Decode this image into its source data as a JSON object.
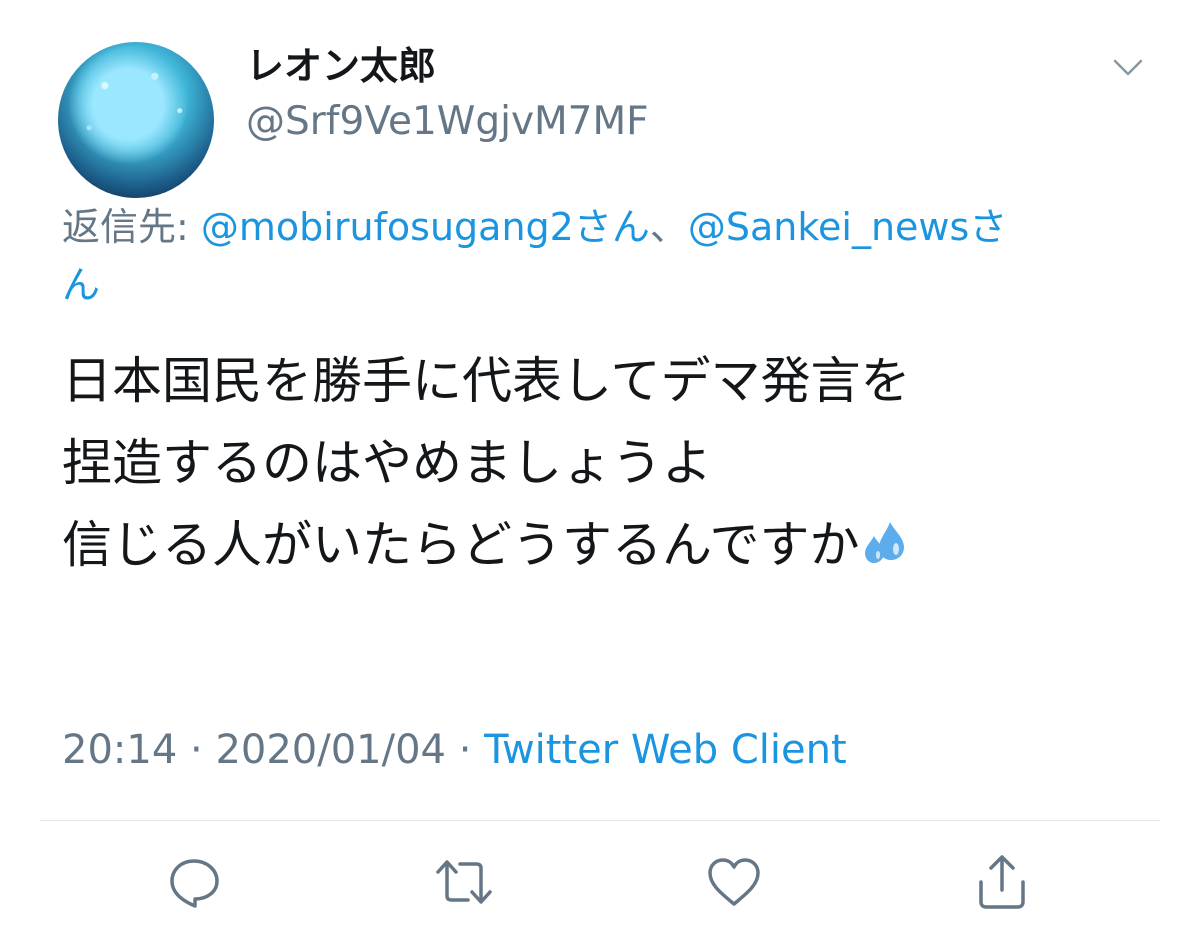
{
  "tweet": {
    "display_name": "レオン太郎",
    "handle": "@Srf9Ve1WgjvM7MF",
    "reply_prefix": "返信先: ",
    "reply_mention_1": "@mobirufosugang2さん",
    "reply_separator": "、",
    "reply_mention_2": "@Sankei_newsさ",
    "reply_mention_2_wrap": "ん",
    "text_lines": [
      "日本国民を勝手に代表してデマ発言を",
      "捏造するのはやめましょうよ",
      "信じる人がいたらどうするんですか"
    ],
    "emoji": "sweat-droplets-emoji",
    "time": "20:14",
    "date": "2020/01/04",
    "separator": " · ",
    "client": "Twitter Web Client"
  },
  "icons": {
    "more": "chevron-down-icon",
    "reply": "reply-icon",
    "retweet": "retweet-icon",
    "like": "like-icon",
    "share": "share-icon"
  },
  "colors": {
    "link": "#1b95e0",
    "secondary_text": "#657786",
    "text": "#14171a",
    "divider": "#e1e8ed"
  }
}
